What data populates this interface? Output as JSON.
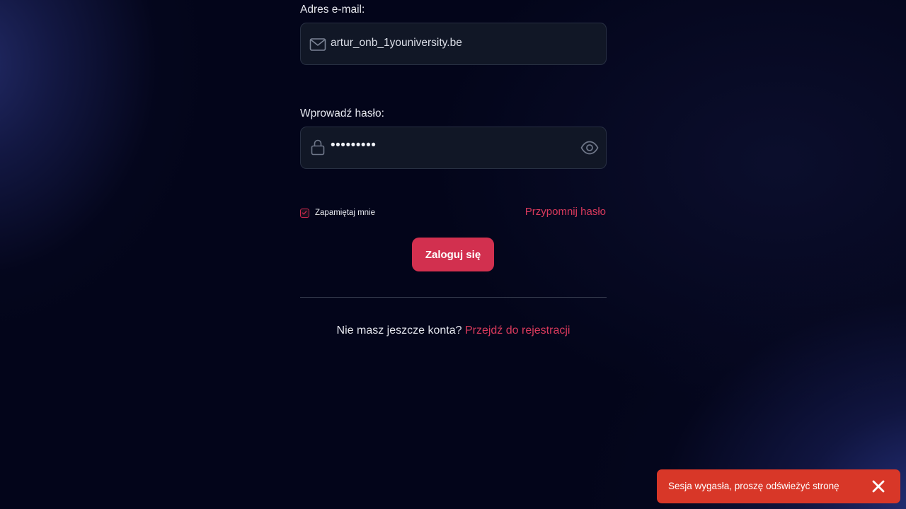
{
  "login_form": {
    "email": {
      "label": "Adres e-mail:",
      "value": "artur_onb_1youniversity.be",
      "icon": "mail-icon"
    },
    "password": {
      "label": "Wprowadź hasło:",
      "value": "•••••••••",
      "icon": "lock-icon",
      "toggle_icon": "eye-icon"
    },
    "remember_me": {
      "label": "Zapamiętaj mnie",
      "checked": true
    },
    "forgot_password_link": "Przypomnij hasło",
    "submit_label": "Zaloguj się",
    "register": {
      "prompt": "Nie masz jeszcze konta?",
      "link": "Przejdź do rejestracji"
    }
  },
  "toast": {
    "message": "Sesja wygasła, proszę odświeżyć stronę",
    "close_icon": "close-icon"
  },
  "colors": {
    "accent": "#d2304f",
    "link": "#d93a5c",
    "toast_background": "#d83728",
    "background": "#03051a",
    "input_background": "#111726"
  }
}
